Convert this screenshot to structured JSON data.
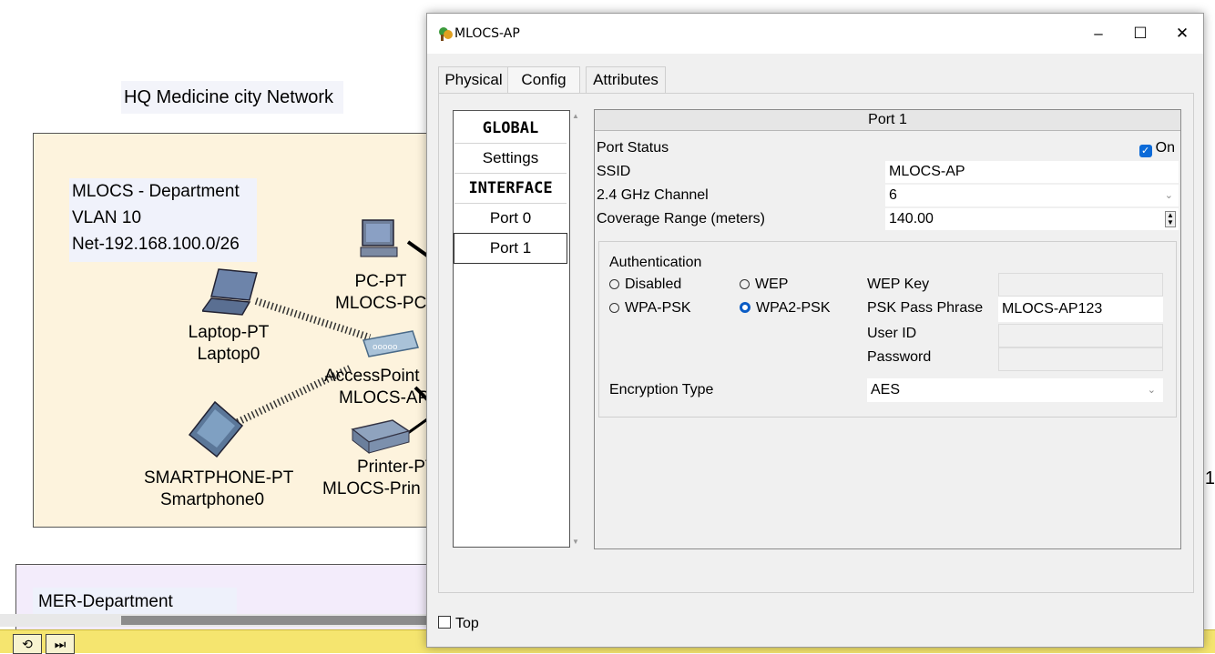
{
  "canvas": {
    "network_title": "HQ Medicine city Network",
    "department": {
      "name": "MLOCS - Department",
      "vlan": "VLAN 10",
      "net": "Net-192.168.100.0/26"
    },
    "devices": [
      {
        "type": "PC-PT",
        "name": "MLOCS-PC"
      },
      {
        "type": "Laptop-PT",
        "name": "Laptop0"
      },
      {
        "type": "AccessPoint",
        "name": "MLOCS-AP"
      },
      {
        "type": "SMARTPHONE-PT",
        "name": "Smartphone0"
      },
      {
        "type": "Printer-PT",
        "name": "MLOCS-Prin"
      }
    ],
    "second_department": "MER-Department",
    "edge_number": "1"
  },
  "dialog": {
    "title": "MLOCS-AP",
    "controls": {
      "minimize": "–",
      "maximize": "☐",
      "close": "✕"
    },
    "tabs": [
      "Physical",
      "Config",
      "Attributes"
    ],
    "active_tab": "Config",
    "sidebar": [
      "GLOBAL",
      "Settings",
      "INTERFACE",
      "Port 0",
      "Port 1"
    ],
    "port": {
      "header": "Port 1",
      "status_label": "Port Status",
      "status_value": "On",
      "ssid_label": "SSID",
      "ssid_value": "MLOCS-AP",
      "channel_label": "2.4 GHz Channel",
      "channel_value": "6",
      "range_label": "Coverage Range (meters)",
      "range_value": "140.00"
    },
    "auth": {
      "title": "Authentication",
      "options": [
        "Disabled",
        "WEP",
        "WPA-PSK",
        "WPA2-PSK"
      ],
      "selected": "WPA2-PSK",
      "wep_key_label": "WEP Key",
      "psk_label": "PSK Pass Phrase",
      "psk_value": "MLOCS-AP123",
      "user_id_label": "User ID",
      "password_label": "Password",
      "encryption_label": "Encryption Type",
      "encryption_value": "AES"
    },
    "top_label": "Top"
  }
}
